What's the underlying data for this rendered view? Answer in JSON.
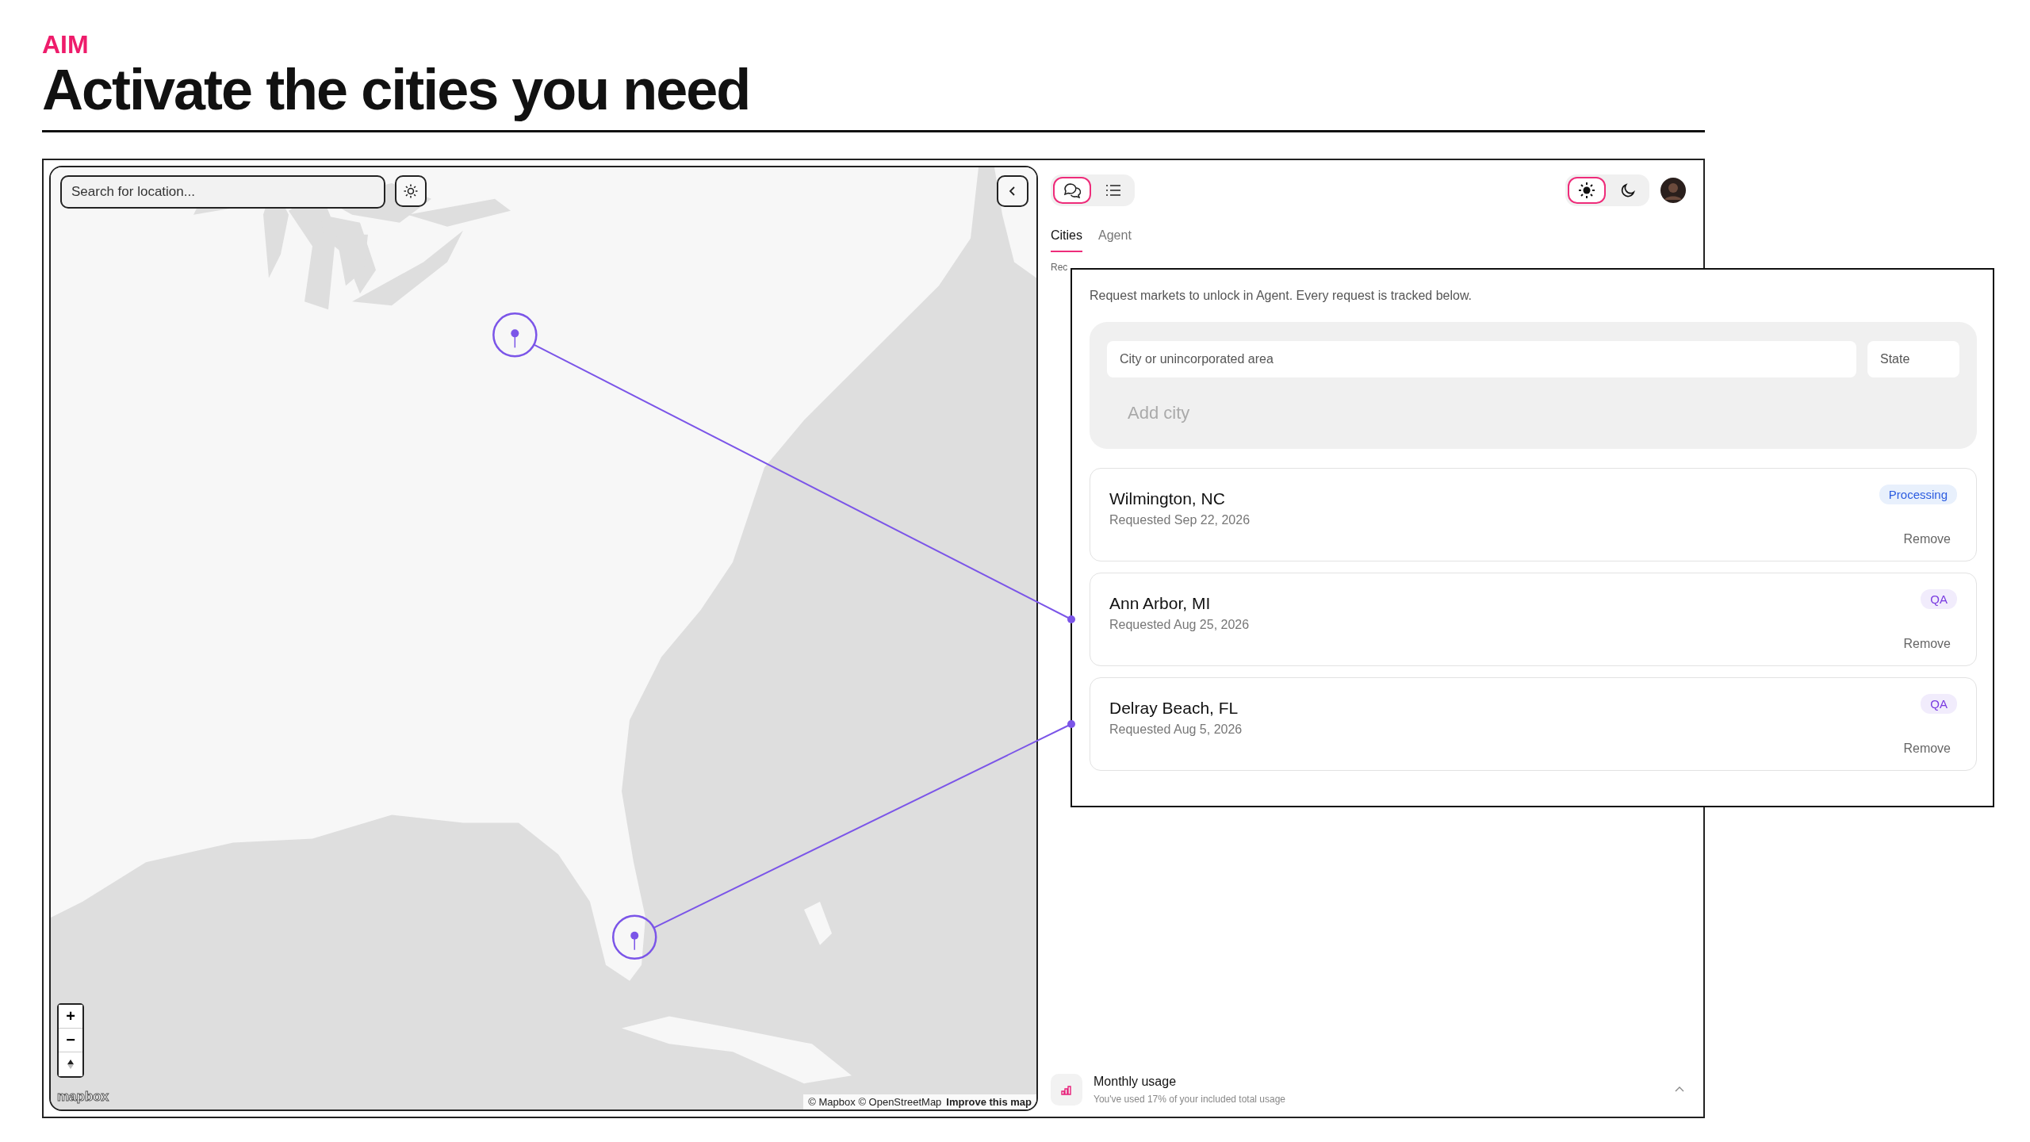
{
  "slide": {
    "eyebrow": "AIM",
    "title": "Activate the cities you need"
  },
  "map": {
    "search": {
      "placeholder": "Search for location..."
    },
    "zoom_controls": [
      "+",
      "−"
    ],
    "logo": "mapbox",
    "attribution": "© Mapbox © OpenStreetMap",
    "improve_link": "Improve this map"
  },
  "panel": {
    "view_toggle": [
      {
        "kind": "chat",
        "selected": true
      },
      {
        "kind": "list",
        "selected": false
      }
    ],
    "theme_toggle": [
      {
        "kind": "light",
        "selected": true
      },
      {
        "kind": "dark",
        "selected": false
      }
    ],
    "tabs": [
      {
        "label": "Cities",
        "selected": true
      },
      {
        "label": "Agent",
        "selected": false
      }
    ],
    "cut_text": "Rec",
    "usage": {
      "title": "Monthly usage",
      "subtitle": "You've used 17% of your included total usage"
    }
  },
  "requests_popup": {
    "intro": "Request markets to unlock in Agent. Every request is tracked below.",
    "city_field": {
      "placeholder": "City or unincorporated area"
    },
    "state_field": {
      "placeholder": "State"
    },
    "add_button": "Add city",
    "requests": [
      {
        "city": "Wilmington, NC",
        "date": "Requested Sep 22, 2026",
        "status": "Processing",
        "kind": "processing",
        "action": "Remove",
        "on_map": false
      },
      {
        "city": "Ann Arbor, MI",
        "date": "Requested Aug 25, 2026",
        "status": "QA",
        "kind": "qa",
        "action": "Remove",
        "on_map": true
      },
      {
        "city": "Delray Beach, FL",
        "date": "Requested Aug 5, 2026",
        "status": "QA",
        "kind": "qa",
        "action": "Remove",
        "on_map": true
      }
    ]
  }
}
